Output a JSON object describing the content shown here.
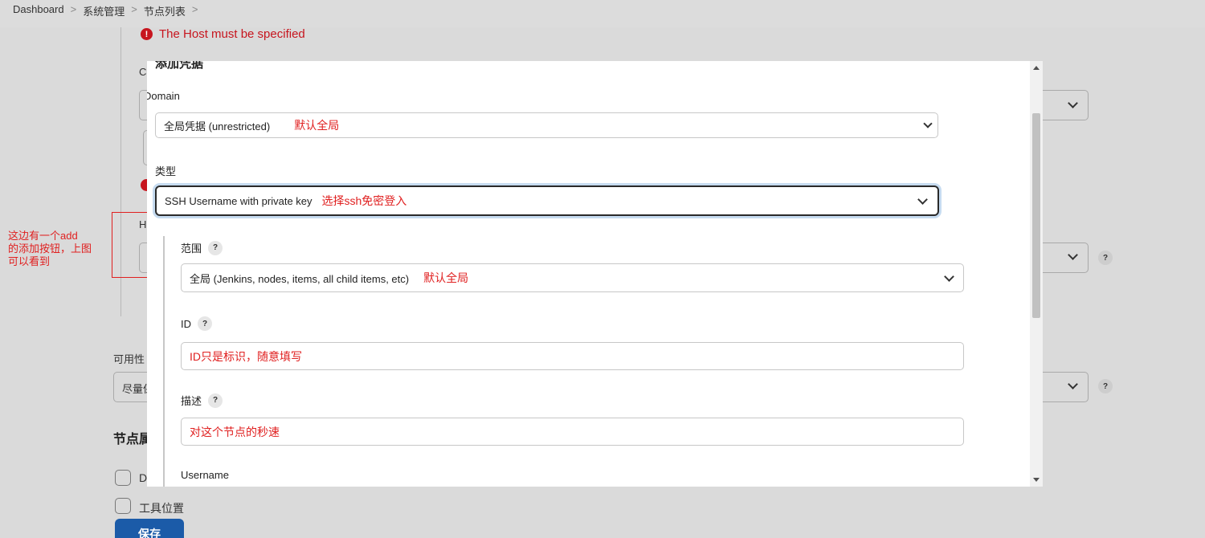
{
  "breadcrumb": [
    "Dashboard",
    "系统管理",
    "节点列表"
  ],
  "breadcrumb_separator": ">",
  "background": {
    "error": "The Host must be specified",
    "error_icon": "!",
    "labels": {
      "c": "C",
      "h": "H",
      "availability": "可用性",
      "availability_value": "尽量保",
      "node_props": "节点属",
      "check1": "D",
      "check2": "工具位置"
    },
    "save_label": "保存"
  },
  "annotation": {
    "text": "这边有一个add\n的添加按钮，上图\n可以看到"
  },
  "modal": {
    "title": "添加凭据",
    "domain": {
      "label": "Domain",
      "value": "全局凭据 (unrestricted)",
      "note": "默认全局"
    },
    "kind": {
      "label": "类型",
      "value": "SSH Username with private key",
      "note": "选择ssh免密登入"
    },
    "scope": {
      "label": "范围",
      "value": "全局 (Jenkins, nodes, items, all child items, etc)",
      "note": "默认全局"
    },
    "id": {
      "label": "ID",
      "value": "ID只是标识，随意填写"
    },
    "description": {
      "label": "描述",
      "value": "对这个节点的秒速"
    },
    "username": {
      "label": "Username"
    },
    "help": "?"
  }
}
